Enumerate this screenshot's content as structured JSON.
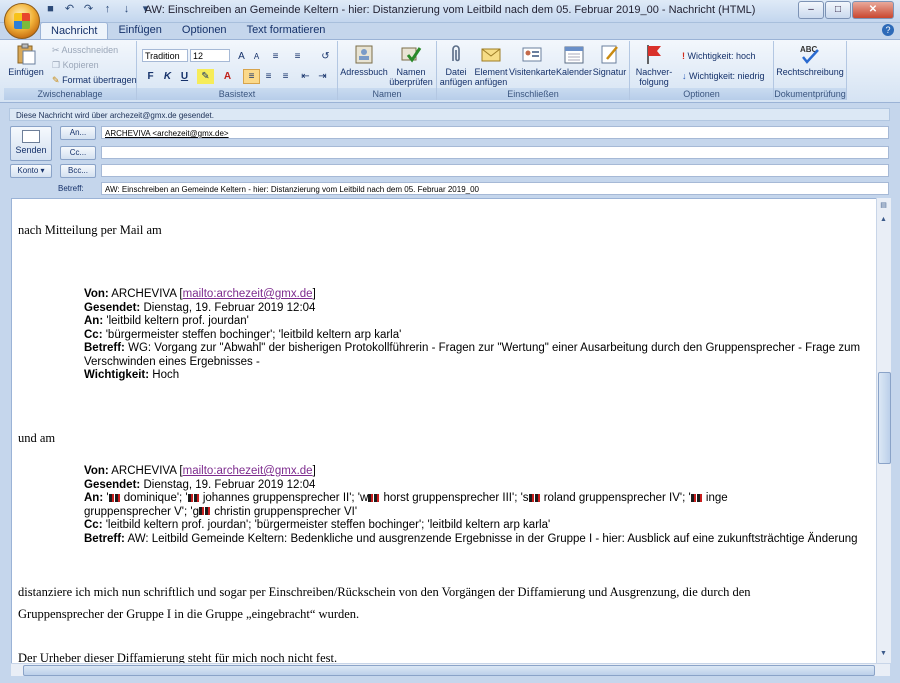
{
  "window": {
    "title": "AW: Einschreiben an Gemeinde Keltern - hier: Distanzierung vom Leitbild nach dem 05. Februar 2019_00 - Nachricht (HTML)",
    "tabs": [
      "Nachricht",
      "Einfügen",
      "Optionen",
      "Text formatieren"
    ],
    "help": "?"
  },
  "ribbon": {
    "clipboard": {
      "paste": "Einfügen",
      "cut": "Ausschneiden",
      "copy": "Kopieren",
      "format_painter": "Format übertragen",
      "label": "Zwischenablage"
    },
    "basic_text": {
      "font": "Tradition",
      "size": "12",
      "label": "Basistext"
    },
    "names": {
      "address_book": "Adressbuch",
      "check_names_1": "Namen",
      "check_names_2": "überprüfen",
      "label": "Namen"
    },
    "include": {
      "attach_1": "Datei",
      "attach_2": "anfügen",
      "item_1": "Element",
      "item_2": "anfügen",
      "card": "Visitenkarte",
      "calendar": "Kalender",
      "signature": "Signatur",
      "label": "Einschließen"
    },
    "options": {
      "followup_1": "Nachver-",
      "followup_2": "folgung",
      "high": "Wichtigkeit: hoch",
      "low": "Wichtigkeit: niedrig",
      "label": "Optionen"
    },
    "proofing": {
      "spelling": "Rechtschreibung",
      "label": "Dokumentprüfung"
    }
  },
  "infobar": "Diese Nachricht wird über archezeit@gmx.de gesendet.",
  "header": {
    "send": "Senden",
    "account": "Konto",
    "to_btn": "An...",
    "cc_btn": "Cc...",
    "bcc_btn": "Bcc...",
    "to_value": "ARCHEVIVA <archezeit@gmx.de>",
    "cc_value": "",
    "bcc_value": "",
    "subject_label": "Betreff:",
    "subject_value": "AW: Einschreiben an Gemeinde Keltern - hier: Distanzierung vom Leitbild nach dem 05. Februar 2019_00"
  },
  "message": {
    "line1": "nach Mitteilung per Mail am",
    "q1": {
      "von_label": "Von:",
      "von": "ARCHEVIVA [",
      "von_link": "mailto:archezeit@gmx.de",
      "von_end": "]",
      "gesendet_label": "Gesendet:",
      "gesendet": "Dienstag, 19. Februar 2019 12:04",
      "an_label": "An:",
      "an": "'leitbild keltern prof. jourdan'",
      "cc_label": "Cc:",
      "cc": "'bürgermeister steffen bochinger'; 'leitbild keltern arp karla'",
      "betreff_label": "Betreff:",
      "betreff_1": "WG: Vorgang zur \"Abwahl\" der bisherigen Protokollführerin - Fragen zur \"Wertung\" einer Ausarbeitung durch den Gruppensprecher - Frage zum",
      "betreff_2": "Verschwinden eines Ergebnisses -",
      "wichtigkeit_label": "Wichtigkeit:",
      "wichtigkeit": "Hoch"
    },
    "line2": "und am",
    "q2": {
      "von_label": "Von:",
      "von": "ARCHEVIVA [",
      "von_link": "mailto:archezeit@gmx.de",
      "von_end": "]",
      "gesendet_label": "Gesendet:",
      "gesendet": "Dienstag, 19. Februar 2019 12:04",
      "an_label": "An:",
      "an_1a": "'",
      "an_1b": " dominique'; '",
      "an_1c": " johannes gruppensprecher II'; 'w",
      "an_1d": " horst gruppensprecher III'; 's",
      "an_1e": " roland gruppensprecher IV'; '",
      "an_1f": " inge",
      "an_2a": "gruppensprecher V'; 'g",
      "an_2b": " christin gruppensprecher VI'",
      "cc_label": "Cc:",
      "cc": "'leitbild keltern prof. jourdan'; 'bürgermeister steffen bochinger'; 'leitbild keltern arp karla'",
      "betreff_label": "Betreff:",
      "betreff": "AW: Leitbild Gemeinde Keltern: Bedenkliche und ausgrenzende Ergebnisse in der Gruppe I - hier: Ausblick auf eine zukunftsträchtige Änderung"
    },
    "para_1": "distanziere ich mich nun schriftlich und sogar per Einschreiben/Rückschein von den Vorgängen der Diffamierung und Ausgrenzung, die durch den",
    "para_2": "Gruppensprecher der Gruppe I in die Gruppe „eingebracht“ wurden.",
    "para_3": "Der Urheber dieser Diffamierung steht für mich noch nicht fest."
  }
}
